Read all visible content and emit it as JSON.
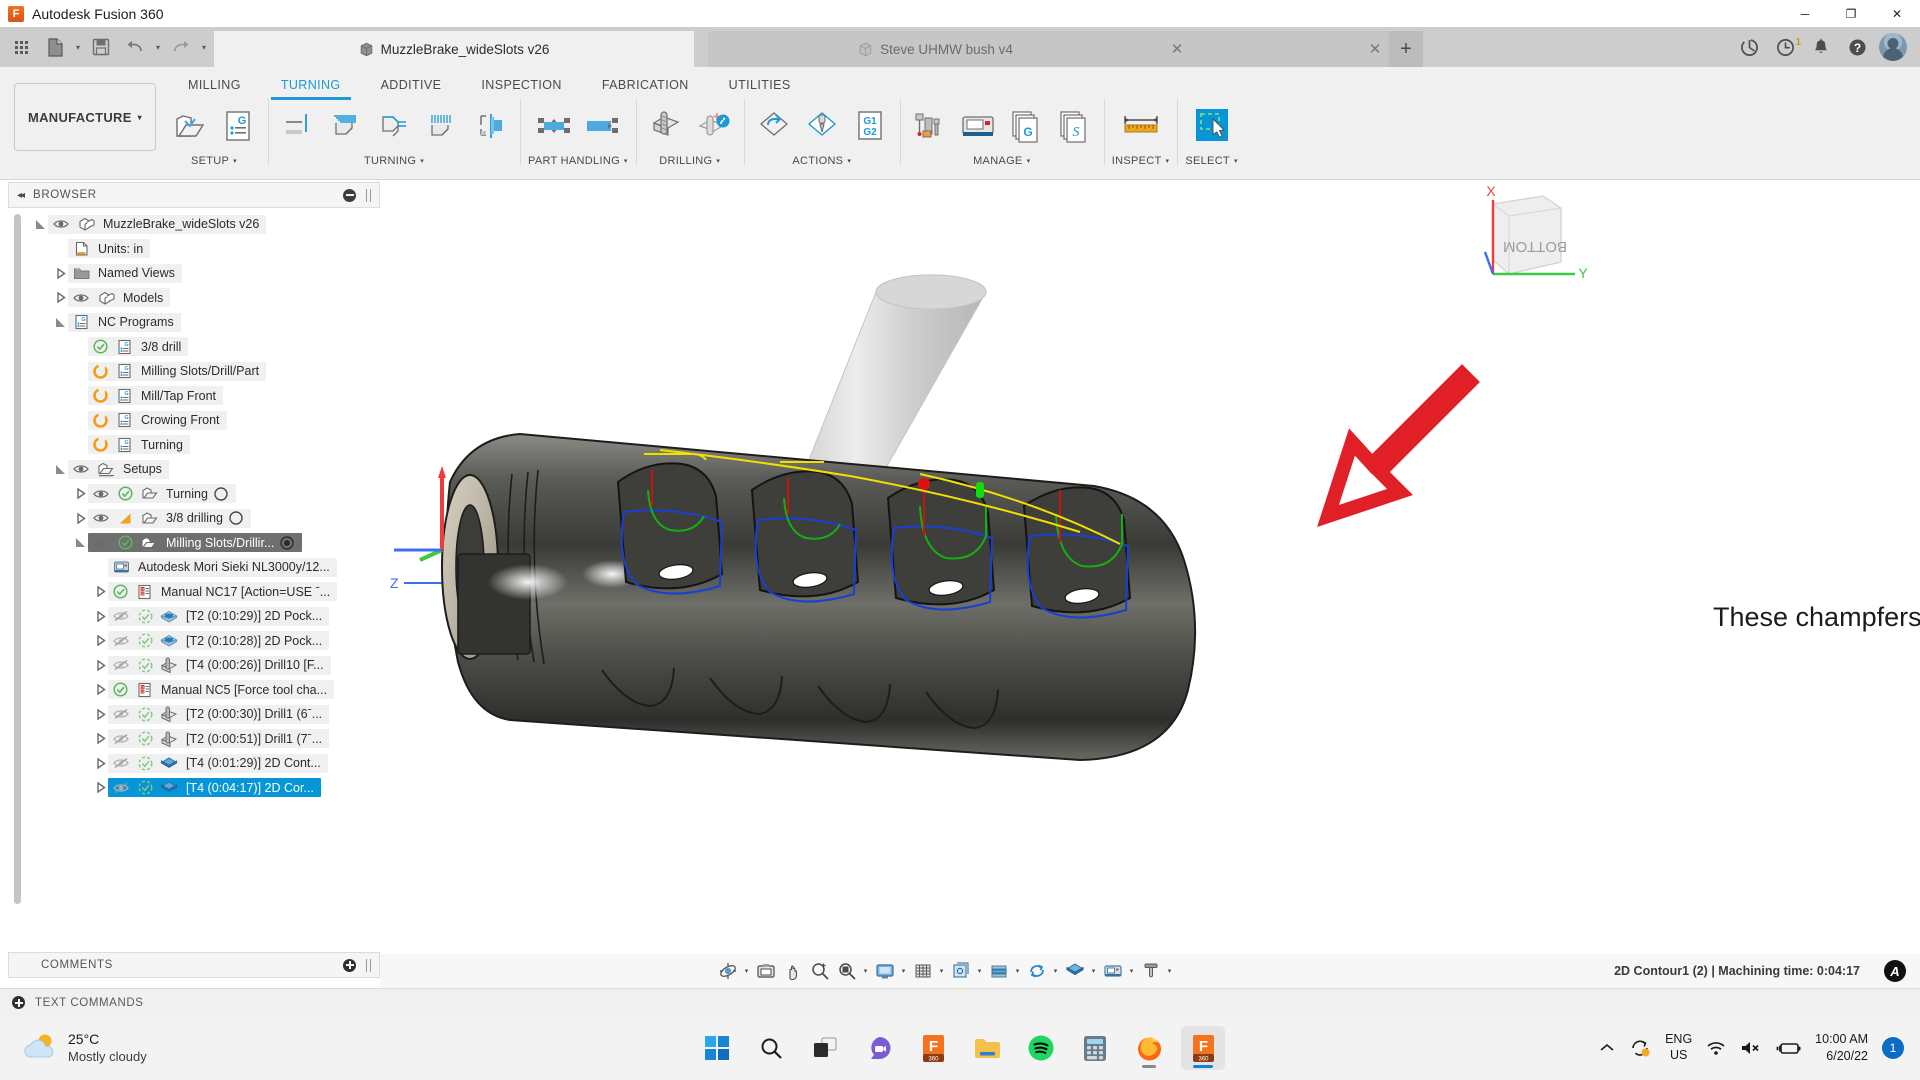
{
  "window": {
    "title": "Autodesk Fusion 360",
    "app_icon": "fusion360-icon",
    "minimize": "─",
    "maximize": "❐",
    "close": "✕"
  },
  "quick_access": {
    "grid": "app-grid-icon",
    "new": "new-document-icon",
    "save": "save-icon",
    "undo": "undo-icon",
    "redo": "redo-icon",
    "caret": "▾"
  },
  "doc_tabs": [
    {
      "label": "Steve UHMW bush v4",
      "active": false,
      "icon": "cube-icon",
      "close": "✕"
    },
    {
      "label": "MuzzleBrake_wideSlots v26",
      "active": true,
      "icon": "cube-icon",
      "close": "✕"
    }
  ],
  "tab_add": "+",
  "sys_icons": [
    {
      "name": "globe-sync-icon",
      "badge": ""
    },
    {
      "name": "job-status-clock-icon",
      "badge": "1"
    },
    {
      "name": "notification-bell-icon",
      "badge": ""
    },
    {
      "name": "help-icon",
      "badge": ""
    },
    {
      "name": "account-avatar",
      "badge": ""
    }
  ],
  "ribbon": {
    "workspace": {
      "label": "MANUFACTURE",
      "caret": "▾"
    },
    "tabs": [
      {
        "label": "MILLING",
        "active": false
      },
      {
        "label": "TURNING",
        "active": true
      },
      {
        "label": "ADDITIVE",
        "active": false
      },
      {
        "label": "INSPECTION",
        "active": false
      },
      {
        "label": "FABRICATION",
        "active": false
      },
      {
        "label": "UTILITIES",
        "active": false
      }
    ],
    "panels": [
      {
        "label": "SETUP",
        "caret": "▾",
        "tools": [
          "setup-folder-icon",
          "nc-program-icon"
        ]
      },
      {
        "label": "TURNING",
        "caret": "▾",
        "tools": [
          "turning-face-icon",
          "turning-profile-icon",
          "turning-groove-icon",
          "turning-thread-icon",
          "turning-part-icon"
        ]
      },
      {
        "label": "PART HANDLING",
        "caret": "▾",
        "tools": [
          "part-transfer-icon",
          "part-stock-transfer-icon"
        ]
      },
      {
        "label": "DRILLING",
        "caret": "▾",
        "tools": [
          "drill-icon",
          "drill-probe-icon"
        ]
      },
      {
        "label": "ACTIONS",
        "caret": "▾",
        "tools": [
          "action-orientation-icon",
          "action-tool-icon",
          "action-g1g2-icon"
        ]
      },
      {
        "label": "MANAGE",
        "caret": "▾",
        "tools": [
          "tool-library-icon",
          "machine-library-icon",
          "post-library-icon",
          "template-library-icon"
        ]
      },
      {
        "label": "INSPECT",
        "caret": "▾",
        "tools": [
          "measure-icon"
        ]
      },
      {
        "label": "SELECT",
        "caret": "▾",
        "tools": [
          "select-window-icon"
        ]
      }
    ]
  },
  "browser": {
    "title": "BROWSER",
    "collapse_icon": "collapse-left-icon",
    "minimize_icon": "minimize-dot-icon",
    "grip_icon": "panel-grip-icon",
    "nodes": [
      {
        "indent": 0,
        "arrow": "open",
        "eye": "visible",
        "status": "",
        "icon": "component-icon",
        "label": "MuzzleBrake_wideSlots v26",
        "trail": "",
        "state": ""
      },
      {
        "indent": 1,
        "arrow": "",
        "eye": "",
        "status": "",
        "icon": "units-icon",
        "label": "Units: in",
        "trail": "",
        "state": ""
      },
      {
        "indent": 1,
        "arrow": "closed",
        "eye": "",
        "status": "",
        "icon": "folder-icon",
        "label": "Named Views",
        "trail": "",
        "state": ""
      },
      {
        "indent": 1,
        "arrow": "closed",
        "eye": "visible",
        "status": "",
        "icon": "component-icon",
        "label": "Models",
        "trail": "",
        "state": ""
      },
      {
        "indent": 1,
        "arrow": "open",
        "eye": "",
        "status": "",
        "icon": "nc-program-icon",
        "label": "NC Programs",
        "trail": "",
        "state": ""
      },
      {
        "indent": 2,
        "arrow": "",
        "eye": "",
        "status": "check",
        "icon": "nc-program-icon",
        "label": "3/8 drill",
        "trail": "",
        "state": ""
      },
      {
        "indent": 2,
        "arrow": "",
        "eye": "",
        "status": "regen",
        "icon": "nc-program-icon",
        "label": "Milling Slots/Drill/Part",
        "trail": "",
        "state": ""
      },
      {
        "indent": 2,
        "arrow": "",
        "eye": "",
        "status": "regen",
        "icon": "nc-program-icon",
        "label": "Mill/Tap Front",
        "trail": "",
        "state": ""
      },
      {
        "indent": 2,
        "arrow": "",
        "eye": "",
        "status": "regen",
        "icon": "nc-program-icon",
        "label": "Crowing Front",
        "trail": "",
        "state": ""
      },
      {
        "indent": 2,
        "arrow": "",
        "eye": "",
        "status": "regen",
        "icon": "nc-program-icon",
        "label": "Turning",
        "trail": "",
        "state": ""
      },
      {
        "indent": 1,
        "arrow": "open",
        "eye": "visible",
        "status": "",
        "icon": "setups-icon",
        "label": "Setups",
        "trail": "",
        "state": ""
      },
      {
        "indent": 2,
        "arrow": "closed",
        "eye": "visible",
        "status": "check",
        "icon": "setup-icon",
        "label": "Turning",
        "trail": "circle",
        "state": ""
      },
      {
        "indent": 2,
        "arrow": "closed",
        "eye": "visible",
        "status": "warn",
        "icon": "setup-icon",
        "label": "3/8 drilling",
        "trail": "circle",
        "state": ""
      },
      {
        "indent": 2,
        "arrow": "open",
        "eye": "visible",
        "status": "check",
        "icon": "setups-icon",
        "label": "Milling Slots/Drillir...",
        "trail": "circle-dot",
        "state": "selected"
      },
      {
        "indent": 3,
        "arrow": "",
        "eye": "",
        "status": "",
        "icon": "machine-icon",
        "label": "Autodesk Mori Sieki NL3000y/12...",
        "trail": "",
        "state": ""
      },
      {
        "indent": 3,
        "arrow": "closed",
        "eye": "",
        "status": "check",
        "icon": "manual-nc-icon",
        "label": "Manual NC17 [Action=USE ˉ...",
        "trail": "",
        "state": ""
      },
      {
        "indent": 3,
        "arrow": "closed",
        "eye": "hidden",
        "status": "check-dash",
        "icon": "pocket-icon",
        "label": "[T2 (0:10:29)] 2D Pock...",
        "trail": "",
        "state": ""
      },
      {
        "indent": 3,
        "arrow": "closed",
        "eye": "hidden",
        "status": "check-dash",
        "icon": "pocket-icon",
        "label": "[T2 (0:10:28)] 2D Pock...",
        "trail": "",
        "state": ""
      },
      {
        "indent": 3,
        "arrow": "closed",
        "eye": "hidden",
        "status": "check-dash",
        "icon": "drill-op-icon",
        "label": "[T4 (0:00:26)] Drill10 [F...",
        "trail": "",
        "state": ""
      },
      {
        "indent": 3,
        "arrow": "closed",
        "eye": "",
        "status": "check",
        "icon": "manual-nc-icon",
        "label": "Manual NC5 [Force tool cha...",
        "trail": "",
        "state": ""
      },
      {
        "indent": 3,
        "arrow": "closed",
        "eye": "hidden",
        "status": "check-dash",
        "icon": "drill-op-icon",
        "label": "[T2 (0:00:30)] Drill1 (6ˉ...",
        "trail": "",
        "state": ""
      },
      {
        "indent": 3,
        "arrow": "closed",
        "eye": "hidden",
        "status": "check-dash",
        "icon": "drill-op-icon",
        "label": "[T2 (0:00:51)] Drill1 (7ˉ...",
        "trail": "",
        "state": ""
      },
      {
        "indent": 3,
        "arrow": "closed",
        "eye": "hidden",
        "status": "check-dash",
        "icon": "contour-icon",
        "label": "[T4 (0:01:29)] 2D Cont...",
        "trail": "",
        "state": ""
      },
      {
        "indent": 3,
        "arrow": "closed",
        "eye": "hidden",
        "status": "check-dash",
        "icon": "contour-icon",
        "label": "[T4 (0:04:17)] 2D Cor...",
        "trail": "",
        "state": "selected-blue"
      }
    ]
  },
  "comments": {
    "title": "COMMENTS",
    "add_icon": "add-comment-icon",
    "grip_icon": "panel-grip-icon"
  },
  "text_commands": {
    "title": "TEXT COMMANDS",
    "expand_icon": "expand-icon"
  },
  "viewport": {
    "annotation": "These champfers.",
    "annotation_color": "#1c1c1c",
    "arrow_color": "#e01f26",
    "viewcube_label": "BOTTOM",
    "axis_x": "X",
    "axis_y": "Y",
    "axis_z": "Z",
    "axis_x_color": "#ef3b3b",
    "axis_y_color": "#3fc93f",
    "axis_z_color": "#3b6fef",
    "toolpath_colors": {
      "cutting": "#1a3fd4",
      "lead": "#12b012",
      "rapid": "#f0e000",
      "plunge": "#cc1111"
    }
  },
  "viewport_toolbar": {
    "items": [
      {
        "name": "orbit-icon",
        "caret": true
      },
      {
        "name": "look-at-icon",
        "caret": false
      },
      {
        "name": "pan-icon",
        "caret": false
      },
      {
        "name": "zoom-icon",
        "caret": false
      },
      {
        "name": "fit-icon",
        "caret": true
      },
      {
        "name": "display-settings-icon",
        "caret": true
      },
      {
        "name": "grid-snap-icon",
        "caret": true
      },
      {
        "name": "viewports-icon",
        "caret": true
      },
      {
        "name": "stock-visibility-icon",
        "caret": true
      },
      {
        "name": "simulation-icon",
        "caret": true
      },
      {
        "name": "toolpath-visibility-icon",
        "caret": true
      },
      {
        "name": "machine-display-icon",
        "caret": true
      },
      {
        "name": "tool-display-icon",
        "caret": true
      }
    ]
  },
  "status_bar": {
    "text": "2D Contour1 (2) | Machining time: 0:04:17",
    "logo": "autodesk-logo"
  },
  "taskbar": {
    "weather": {
      "temp": "25°C",
      "condition": "Mostly cloudy",
      "icon": "partly-cloudy-icon"
    },
    "apps": [
      {
        "name": "start-button",
        "icon": "windows-logo-icon",
        "running": false,
        "active": false
      },
      {
        "name": "search-button",
        "icon": "search-icon",
        "running": false,
        "active": false
      },
      {
        "name": "task-view-button",
        "icon": "task-view-icon",
        "running": false,
        "active": false
      },
      {
        "name": "teams-button",
        "icon": "teams-chat-icon",
        "running": false,
        "active": false
      },
      {
        "name": "fusion360-taskbar-button",
        "icon": "fusion360-icon",
        "running": false,
        "active": false
      },
      {
        "name": "file-explorer-button",
        "icon": "folder-icon",
        "running": false,
        "active": false
      },
      {
        "name": "spotify-button",
        "icon": "spotify-icon",
        "running": false,
        "active": false
      },
      {
        "name": "calculator-button",
        "icon": "calculator-icon",
        "running": false,
        "active": false
      },
      {
        "name": "firefox-button",
        "icon": "firefox-icon",
        "running": true,
        "active": false
      },
      {
        "name": "fusion360-active-button",
        "icon": "fusion360-icon",
        "running": true,
        "active": true
      }
    ],
    "tray": {
      "overflow": "⌃",
      "sync_icon": "onedrive-sync-icon",
      "language": {
        "line1": "ENG",
        "line2": "US"
      },
      "wifi_icon": "wifi-icon",
      "volume_icon": "volume-muted-icon",
      "battery_icon": "battery-charging-icon",
      "time": "10:00 AM",
      "date": "6/20/22",
      "notification_count": "1"
    }
  }
}
